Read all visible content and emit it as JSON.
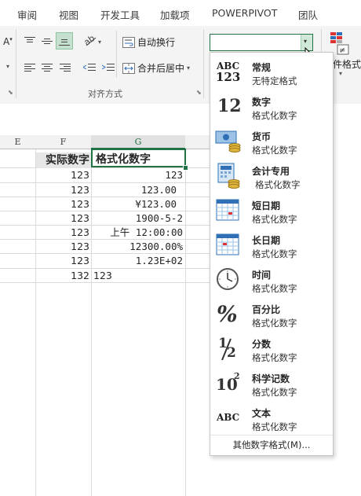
{
  "tabs": [
    "审阅",
    "视图",
    "开发工具",
    "加载项",
    "POWERPIVOT",
    "团队"
  ],
  "ribbon": {
    "wrap_text": "自动换行",
    "merge_center": "合并后居中",
    "alignment_group": "对齐方式",
    "cond_format_partial": "件格式",
    "font_letter": "A"
  },
  "sheet": {
    "columns": [
      "E",
      "F",
      "G"
    ],
    "header_f": "实际数字",
    "header_g": "格式化数字",
    "rows": [
      {
        "f": "123",
        "g": "123"
      },
      {
        "f": "123",
        "g": "123.00"
      },
      {
        "f": "123",
        "g": "¥123.00"
      },
      {
        "f": "123",
        "g": "1900-5-2"
      },
      {
        "f": "123",
        "g": "上午 12:00:00"
      },
      {
        "f": "123",
        "g": "12300.00%"
      },
      {
        "f": "123",
        "g": "1.23E+02"
      },
      {
        "f": "132",
        "g": "123"
      }
    ]
  },
  "number_format_menu": {
    "items": [
      {
        "title": "常规",
        "subtitle": "无特定格式",
        "icon": "general-abc123-icon"
      },
      {
        "title": "数字",
        "subtitle": "格式化数字",
        "icon": "number-12-icon"
      },
      {
        "title": "货币",
        "subtitle": "格式化数字",
        "icon": "currency-icon"
      },
      {
        "title": "会计专用",
        "subtitle": "格式化数字",
        "icon": "accounting-icon"
      },
      {
        "title": "短日期",
        "subtitle": "格式化数字",
        "icon": "short-date-calendar-icon"
      },
      {
        "title": "长日期",
        "subtitle": "格式化数字",
        "icon": "long-date-calendar-icon"
      },
      {
        "title": "时间",
        "subtitle": "格式化数字",
        "icon": "clock-icon"
      },
      {
        "title": "百分比",
        "subtitle": "格式化数字",
        "icon": "percent-icon"
      },
      {
        "title": "分数",
        "subtitle": "格式化数字",
        "icon": "fraction-icon"
      },
      {
        "title": "科学记数",
        "subtitle": "格式化数字",
        "icon": "scientific-icon"
      },
      {
        "title": "文本",
        "subtitle": "格式化数字",
        "icon": "text-abc-icon"
      }
    ],
    "more": "其他数字格式(M)...",
    "icon_text": {
      "abc": "ABC",
      "n123": "123",
      "n12": "12",
      "pct": "%",
      "frac_top": "1",
      "frac_bot": "2",
      "sci_base": "10",
      "sci_exp": "2",
      "text_abc": "ABC"
    }
  },
  "colors": {
    "accent_green": "#217346",
    "selection_border": "#217346"
  }
}
